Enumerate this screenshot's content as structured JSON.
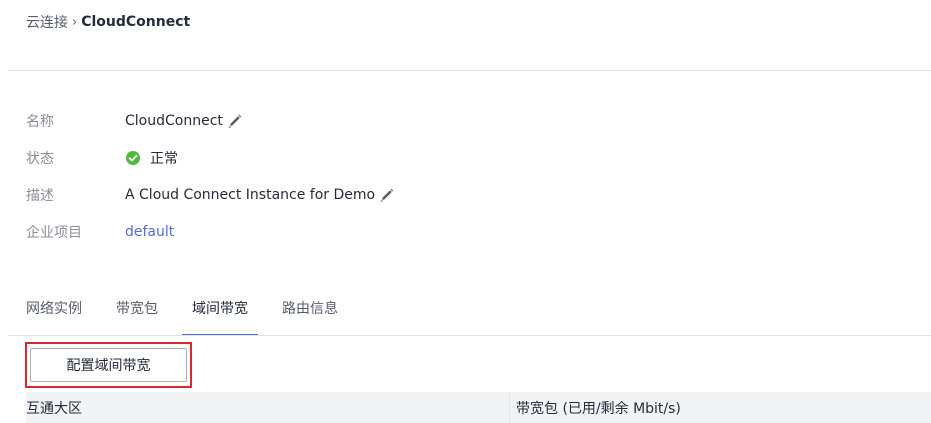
{
  "breadcrumb": {
    "parent": "云连接",
    "separator": "›",
    "current": "CloudConnect"
  },
  "info": {
    "name_label": "名称",
    "name_value": "CloudConnect",
    "status_label": "状态",
    "status_value": "正常",
    "status_color": "#50b83c",
    "description_label": "描述",
    "description_value": "A Cloud Connect Instance for Demo",
    "project_label": "企业项目",
    "project_value": "default"
  },
  "tabs": [
    {
      "label": "网络实例",
      "active": false
    },
    {
      "label": "带宽包",
      "active": false
    },
    {
      "label": "域间带宽",
      "active": true
    },
    {
      "label": "路由信息",
      "active": false
    }
  ],
  "actions": {
    "config_button_label": "配置域间带宽"
  },
  "table": {
    "columns": [
      "互通大区",
      "带宽包 (已用/剩余 Mbit/s)"
    ]
  },
  "colors": {
    "accent": "#526ecc",
    "highlight": "#d9282f",
    "success": "#50b83c"
  }
}
